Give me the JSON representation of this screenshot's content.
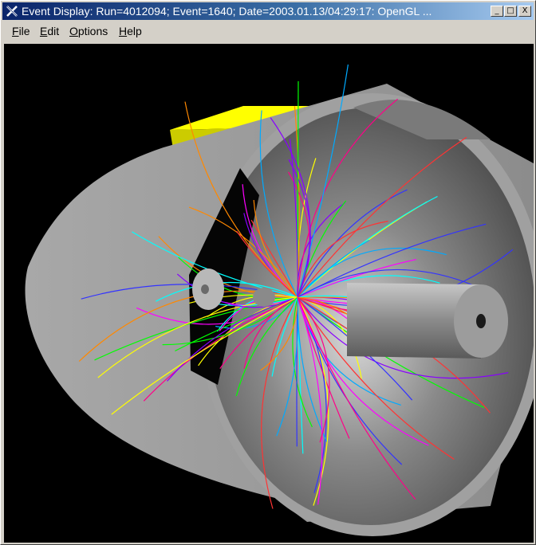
{
  "window": {
    "title": "Event Display: Run=4012094; Event=1640; Date=2003.01.13/04:29:17: OpenGL ...",
    "controls": {
      "minimize": "_",
      "maximize": "□",
      "close": "X"
    }
  },
  "menubar": {
    "items": [
      {
        "label": "File",
        "mnemonic": "F",
        "rest": "ile"
      },
      {
        "label": "Edit",
        "mnemonic": "E",
        "rest": "dit"
      },
      {
        "label": "Options",
        "mnemonic": "O",
        "rest": "ptions"
      },
      {
        "label": "Help",
        "mnemonic": "H",
        "rest": "elp"
      }
    ]
  },
  "viewport": {
    "background": "#000000",
    "detector_color": "#9a9a9a",
    "magnet_color": "#ffff00",
    "track_colors": [
      "#ff00ff",
      "#00ffff",
      "#00ff00",
      "#ffff00",
      "#ff3333",
      "#3333ff",
      "#ff8800",
      "#8800ff",
      "#00aaff",
      "#ff0088"
    ]
  }
}
